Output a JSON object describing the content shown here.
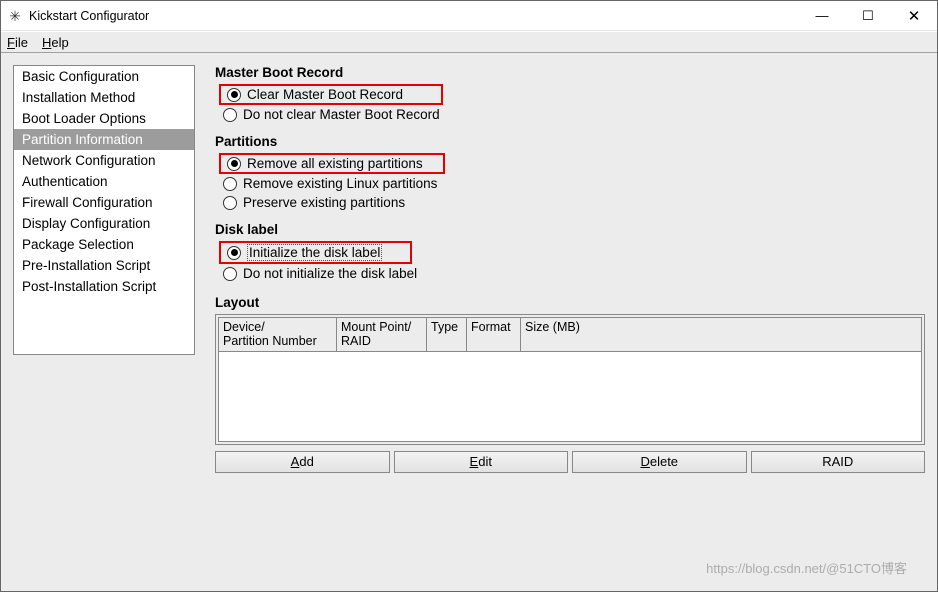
{
  "window": {
    "title": "Kickstart Configurator"
  },
  "menu": {
    "file": "File",
    "help": "Help"
  },
  "sidebar": {
    "items": [
      {
        "label": "Basic Configuration"
      },
      {
        "label": "Installation Method"
      },
      {
        "label": "Boot Loader Options"
      },
      {
        "label": "Partition Information"
      },
      {
        "label": "Network Configuration"
      },
      {
        "label": "Authentication"
      },
      {
        "label": "Firewall Configuration"
      },
      {
        "label": "Display Configuration"
      },
      {
        "label": "Package Selection"
      },
      {
        "label": "Pre-Installation Script"
      },
      {
        "label": "Post-Installation Script"
      }
    ],
    "selected_index": 3
  },
  "mbr": {
    "title": "Master Boot Record",
    "opt_clear": "Clear Master Boot Record",
    "opt_noclear": "Do not clear Master Boot Record",
    "selected": "clear"
  },
  "partitions": {
    "title": "Partitions",
    "opt_remove_all": "Remove all existing partitions",
    "opt_remove_linux": "Remove existing Linux partitions",
    "opt_preserve": "Preserve existing partitions",
    "selected": "remove_all"
  },
  "disklabel": {
    "title": "Disk label",
    "opt_init": "Initialize the disk label",
    "opt_noinit": "Do not initialize the disk label",
    "selected": "init"
  },
  "layout": {
    "title": "Layout",
    "columns": {
      "device": "Device/\nPartition Number",
      "device_l1": "Device/",
      "device_l2": "Partition Number",
      "mount": "Mount Point/\nRAID",
      "mount_l1": "Mount Point/",
      "mount_l2": "RAID",
      "type": "Type",
      "format": "Format",
      "size": "Size (MB)"
    }
  },
  "buttons": {
    "add": "dd",
    "add_u": "A",
    "edit": "dit",
    "edit_u": "E",
    "delete": "elete",
    "delete_u": "D",
    "raid": "RAID"
  },
  "watermark": "https://blog.csdn.net/@51CTO博客"
}
